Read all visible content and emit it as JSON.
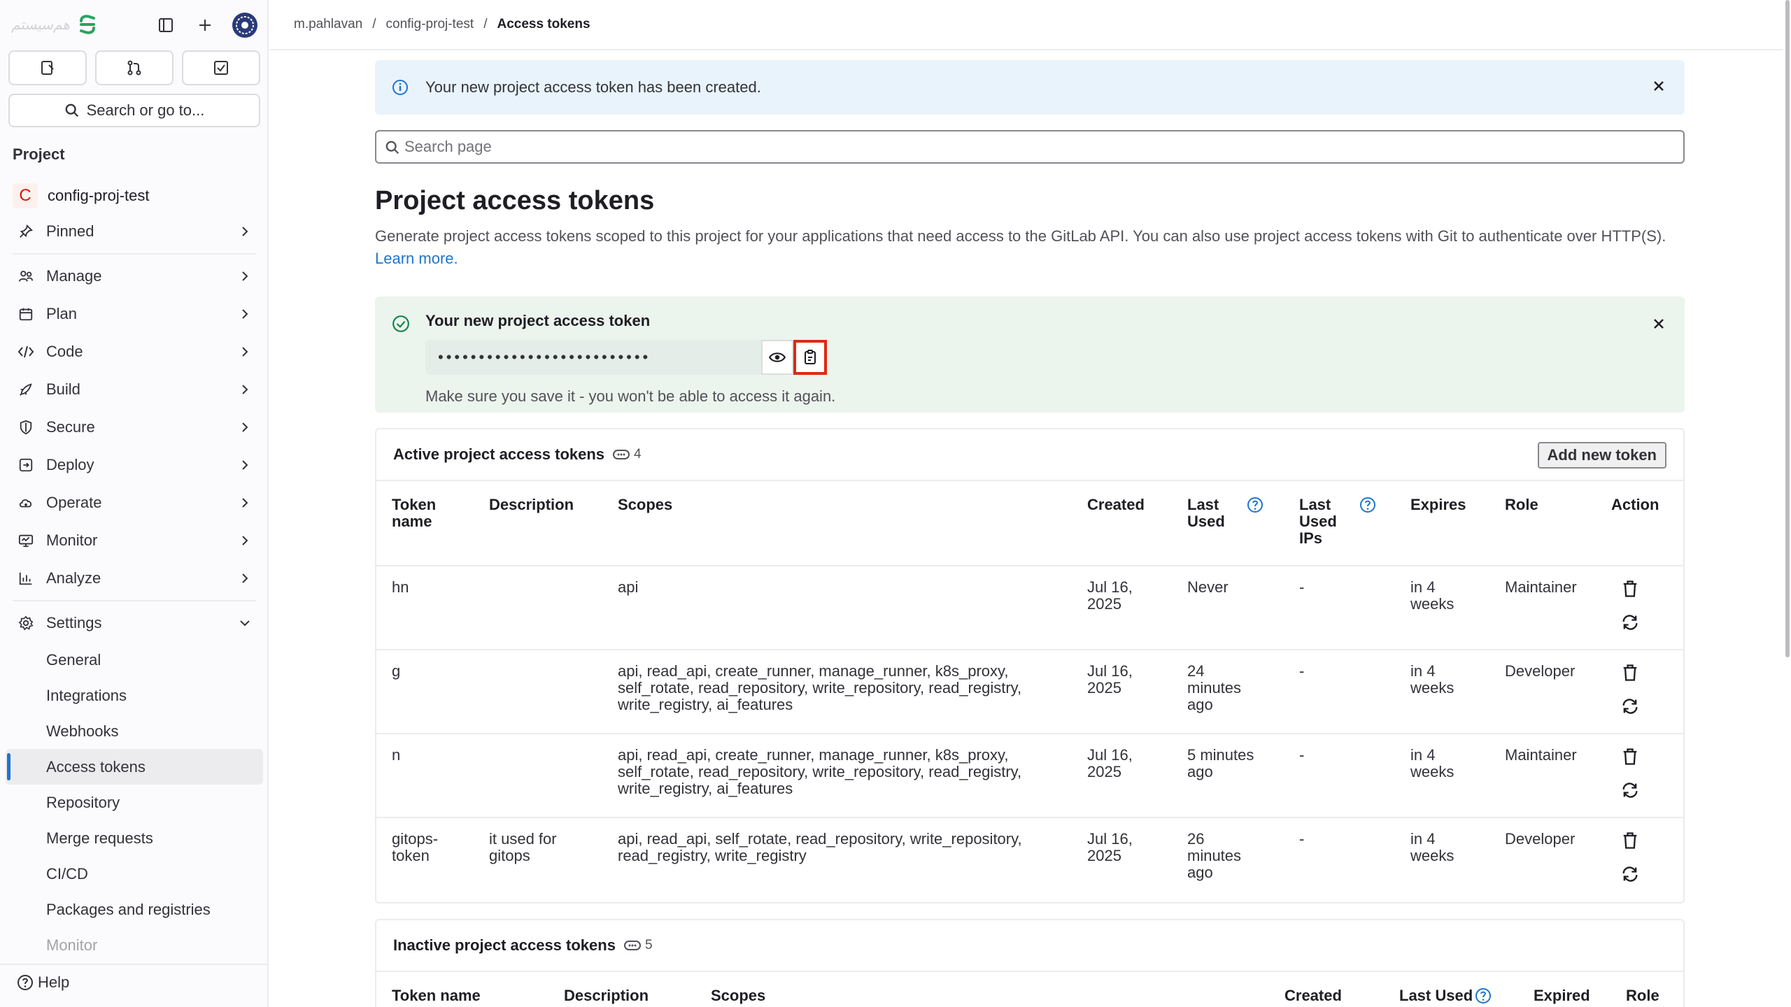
{
  "sidebar": {
    "logo_text": "هم‌سیستم",
    "search_label": "Search or go to...",
    "section_title": "Project",
    "project": {
      "badge": "C",
      "name": "config-proj-test"
    },
    "nav": [
      {
        "label": "Pinned"
      },
      {
        "label": "Manage"
      },
      {
        "label": "Plan"
      },
      {
        "label": "Code"
      },
      {
        "label": "Build"
      },
      {
        "label": "Secure"
      },
      {
        "label": "Deploy"
      },
      {
        "label": "Operate"
      },
      {
        "label": "Monitor"
      },
      {
        "label": "Analyze"
      },
      {
        "label": "Settings"
      }
    ],
    "settings_sub": [
      "General",
      "Integrations",
      "Webhooks",
      "Access tokens",
      "Repository",
      "Merge requests",
      "CI/CD",
      "Packages and registries",
      "Monitor"
    ],
    "help": "Help"
  },
  "breadcrumb": [
    "m.pahlavan",
    "config-proj-test",
    "Access tokens"
  ],
  "alert_info": "Your new project access token has been created.",
  "search_placeholder": "Search page",
  "title": "Project access tokens",
  "description": "Generate project access tokens scoped to this project for your applications that need access to the GitLab API. You can also use project access tokens with Git to authenticate over HTTP(S).",
  "learn_more": "Learn more.",
  "new_token": {
    "title": "Your new project access token",
    "masked_value": "••••••••••••••••••••••••••",
    "note": "Make sure you save it - you won't be able to access it again."
  },
  "active": {
    "title": "Active project access tokens",
    "count": "4",
    "add_button": "Add new token",
    "headers": {
      "name": [
        "Token",
        "name"
      ],
      "description": "Description",
      "scopes": "Scopes",
      "created": "Created",
      "last_used": [
        "Last",
        "Used"
      ],
      "last_used_ips": [
        "Last",
        "Used",
        "IPs"
      ],
      "expires": "Expires",
      "role": "Role",
      "action": "Action"
    },
    "rows": [
      {
        "name": [
          "hn"
        ],
        "description": [
          ""
        ],
        "scopes": [
          "api"
        ],
        "created": [
          "Jul 16,",
          "2025"
        ],
        "last_used": [
          "Never"
        ],
        "ips": "-",
        "expires": [
          "in 4",
          "weeks"
        ],
        "role": "Maintainer"
      },
      {
        "name": [
          "g"
        ],
        "description": [
          ""
        ],
        "scopes": [
          "api, read_api, create_runner, manage_runner, k8s_proxy,",
          "self_rotate, read_repository, write_repository, read_registry,",
          "write_registry, ai_features"
        ],
        "created": [
          "Jul 16,",
          "2025"
        ],
        "last_used": [
          "24",
          "minutes",
          "ago"
        ],
        "ips": "-",
        "expires": [
          "in 4",
          "weeks"
        ],
        "role": "Developer"
      },
      {
        "name": [
          "n"
        ],
        "description": [
          ""
        ],
        "scopes": [
          "api, read_api, create_runner, manage_runner, k8s_proxy,",
          "self_rotate, read_repository, write_repository, read_registry,",
          "write_registry, ai_features"
        ],
        "created": [
          "Jul 16,",
          "2025"
        ],
        "last_used": [
          "5 minutes",
          "ago"
        ],
        "ips": "-",
        "expires": [
          "in 4",
          "weeks"
        ],
        "role": "Maintainer"
      },
      {
        "name": [
          "gitops-",
          "token"
        ],
        "description": [
          "it used for",
          "gitops"
        ],
        "scopes": [
          "api, read_api, self_rotate, read_repository, write_repository,",
          "read_registry, write_registry"
        ],
        "created": [
          "Jul 16,",
          "2025"
        ],
        "last_used": [
          "26",
          "minutes",
          "ago"
        ],
        "ips": "-",
        "expires": [
          "in 4",
          "weeks"
        ],
        "role": "Developer"
      }
    ]
  },
  "inactive": {
    "title": "Inactive project access tokens",
    "count": "5",
    "headers": {
      "name": "Token name",
      "description": "Description",
      "scopes": "Scopes",
      "created": "Created",
      "last_used": "Last Used",
      "expired": "Expired",
      "role": "Role"
    }
  },
  "colors": {
    "accent": "#1f75cb",
    "info_bg": "#e9f3fc",
    "success_bg": "#ecf4ee",
    "success_icon": "#108548",
    "highlight": "#dd2b0e",
    "logo_green": "#2da160"
  }
}
